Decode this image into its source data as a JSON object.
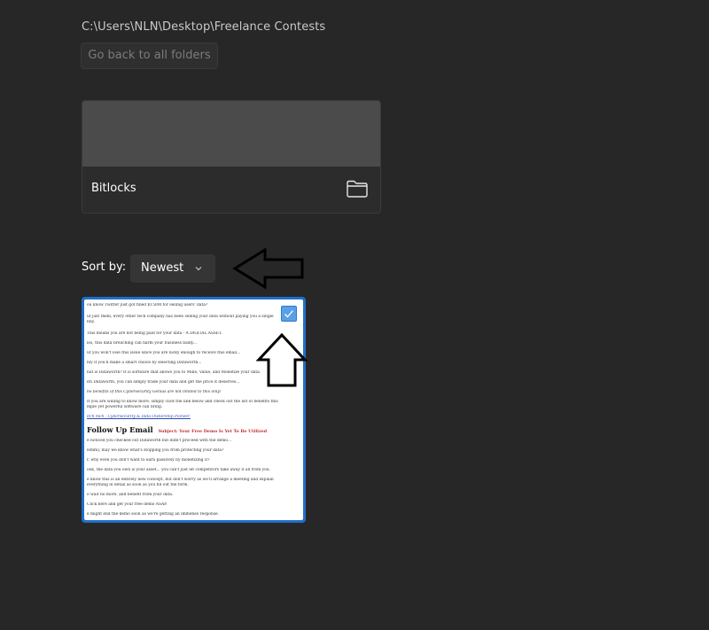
{
  "path": "C:\\Users\\NLN\\Desktop\\Freelance Contests",
  "back_button_label": "Go back to all folders",
  "folders": [
    {
      "name": "Bitlocks",
      "icon": "folder-icon"
    }
  ],
  "sort": {
    "label": "Sort by:",
    "value": "Newest",
    "icon": "chevron-down-icon"
  },
  "annotations": {
    "left_arrow": "arrow-left-icon",
    "up_arrow": "arrow-up-icon"
  },
  "document": {
    "checkbox_checked": true,
    "accent_color": "#1f6fc8",
    "lines": [
      "ou know Twitter just got fined $150M for selling users' data?",
      "ut just them, every other tech company has been selling your data without paying you a single",
      "nny.",
      "This means you are not being paid for your data - A DIGITAL ASSET.",
      "lso, this data breaching can harm your business badly...",
      "ut you won't lose this issue since you are lucky enough to receive this email...",
      "nly if you'll make a smart choice by selecting Dataworth...",
      "hat is Dataworth? It is software that allows you to Mine, Value, and Monetize your data.",
      "ith Dataworth, you can simply trade your data and get the price it deserves...",
      "he benefits of this Cybersecurity Genius are not limited to this only!",
      "If you are willing to know more, simply click the link below and check out the list of benefits this",
      "mple yet powerful software can bring.",
      "itch mch - Cybersecurity & Data Ownership Pioneer.",
      "Follow Up Email",
      "Subject: Your Free Demo Is Yet To Be Utilized",
      "e noticed you checked out Dataworth but didn't proceed with the demo...",
      "Hmm), may we know what's stopping you from protecting your data?",
      "r, why even you don't want to earn passively by monetizing it?",
      "ook, the data you own is your asset... you can't just let competitors take away it all from you.",
      "e know this is an entirely new concept, but don't worry as we'll arrange a meeting and explain",
      "everything in detail as soon as you fill out the form.",
      "o wait no more, and benefit from your data.",
      "Click here and get your free demo ASAP.",
      "e might end the demo soon as we're getting an immense response."
    ]
  }
}
